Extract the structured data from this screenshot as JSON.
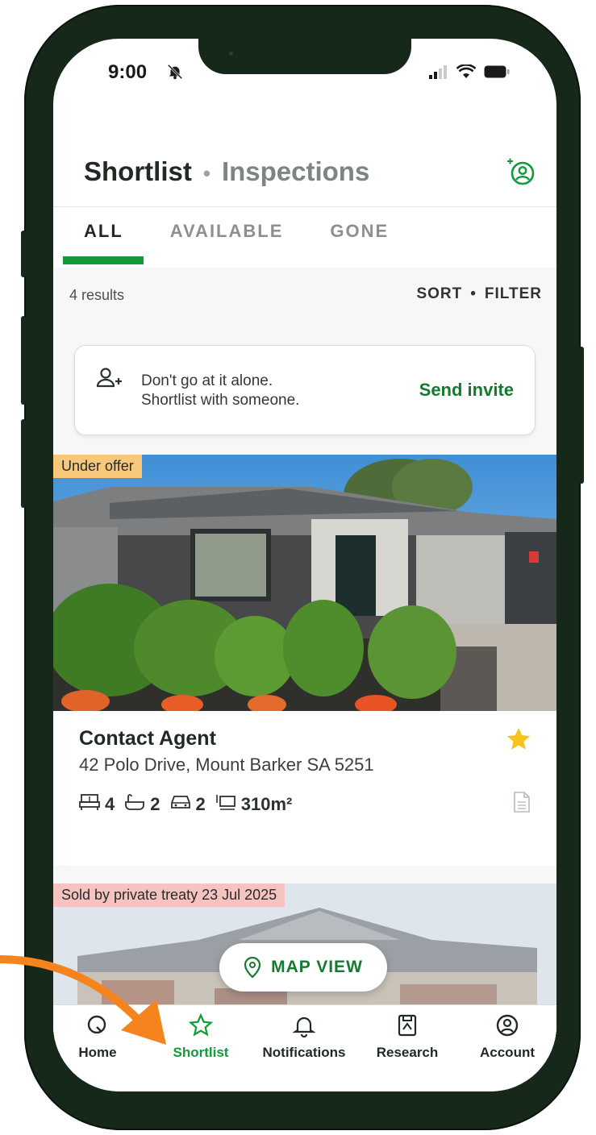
{
  "status_bar": {
    "time": "9:00"
  },
  "header": {
    "active_title": "Shortlist",
    "separator": "•",
    "inactive_title": "Inspections"
  },
  "tabs": [
    {
      "label": "ALL",
      "selected": true
    },
    {
      "label": "AVAILABLE",
      "selected": false
    },
    {
      "label": "GONE",
      "selected": false
    }
  ],
  "results_bar": {
    "count": "4 results",
    "sort": "SORT",
    "bullet": "•",
    "filter": "FILTER"
  },
  "invite_banner": {
    "line1": "Don't go at it alone.",
    "line2": "Shortlist with someone.",
    "action": "Send invite"
  },
  "listings": [
    {
      "badge": "Under offer",
      "price": "Contact Agent",
      "address": "42 Polo Drive, Mount Barker SA 5251",
      "beds": "4",
      "baths": "2",
      "cars": "2",
      "land": "310m²",
      "starred": true
    },
    {
      "badge": "Sold by private treaty 23 Jul 2025"
    }
  ],
  "map_view": {
    "label": "MAP VIEW"
  },
  "nav": [
    {
      "label": "Home",
      "icon": "search-icon",
      "active": false
    },
    {
      "label": "Shortlist",
      "icon": "star-icon",
      "active": true
    },
    {
      "label": "Notifications",
      "icon": "bell-icon",
      "active": false
    },
    {
      "label": "Research",
      "icon": "research-icon",
      "active": false
    },
    {
      "label": "Account",
      "icon": "account-icon",
      "active": false
    }
  ],
  "colors": {
    "brand_green": "#139a39",
    "link_green": "#137a30",
    "arrow_orange": "#f5841f",
    "under_offer": "#f7c87a",
    "sold": "#f5c4c1",
    "star": "#f7c21b"
  }
}
